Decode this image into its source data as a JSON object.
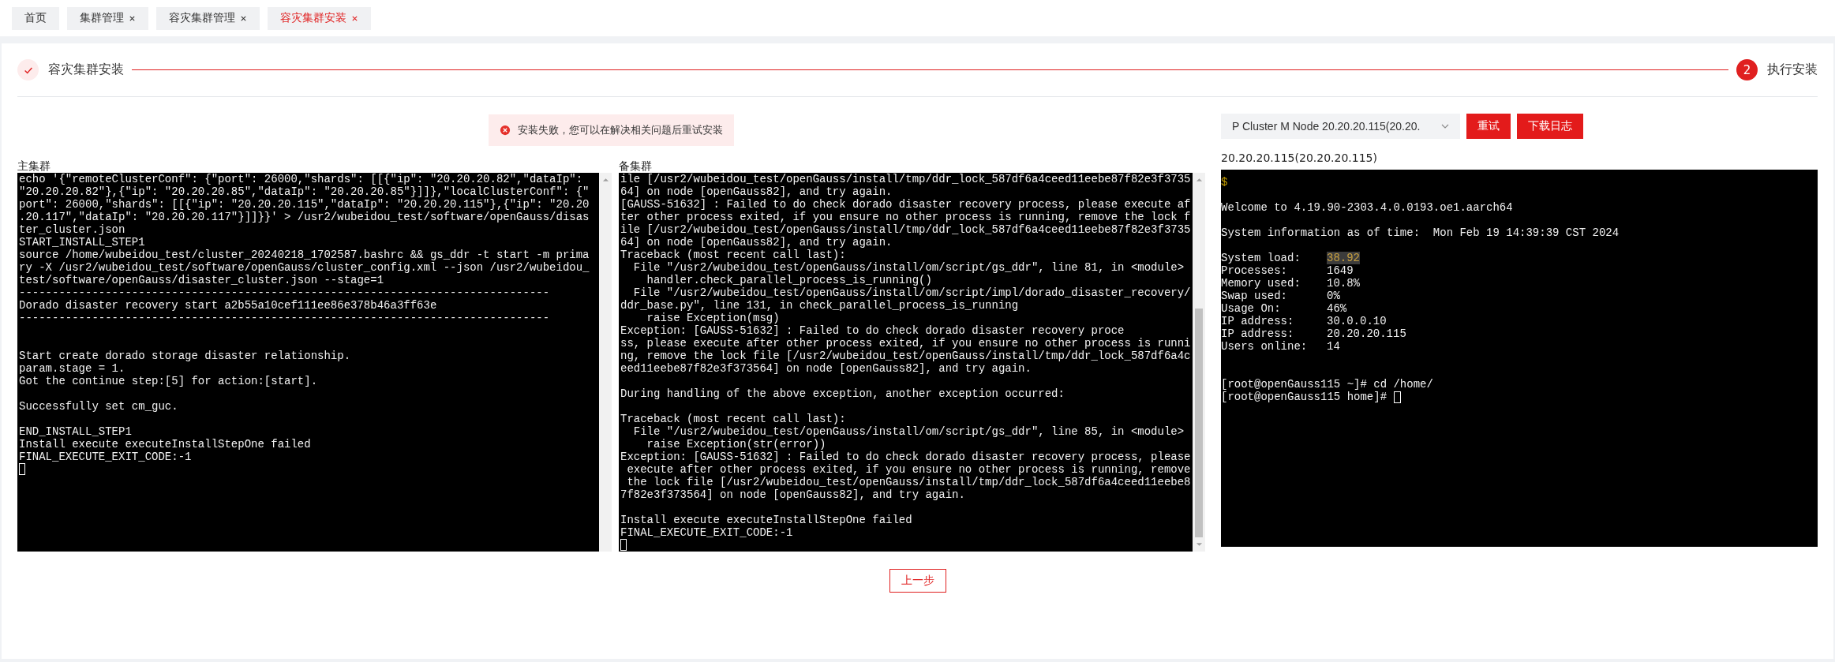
{
  "tabs": [
    {
      "label": "首页",
      "selected": false,
      "closable": false
    },
    {
      "label": "集群管理",
      "selected": false,
      "closable": true
    },
    {
      "label": "容灾集群管理",
      "selected": false,
      "closable": true
    },
    {
      "label": "容灾集群安装",
      "selected": true,
      "closable": true
    }
  ],
  "steps": [
    {
      "title": "容灾集群安装",
      "kind": "done"
    },
    {
      "title": "执行安装",
      "kind": "active",
      "number": "2"
    }
  ],
  "alert": {
    "kind": "error",
    "message": "安装失败，您可以在解决相关问题后重试安装"
  },
  "node_select": {
    "value": "P Cluster M Node 20.20.20.115(20.20."
  },
  "buttons": [
    "重试",
    "下载日志"
  ],
  "primary_terminal": {
    "label": "主集群",
    "output": "echo '{\"remoteClusterConf\": {\"port\": 26000,\"shards\": [[{\"ip\": \"20.20.20.82\",\"dataIp\":\n\"20.20.20.82\"},{\"ip\": \"20.20.20.85\",\"dataIp\": \"20.20.20.85\"}]]},\"localClusterConf\": {\"\nport\": 26000,\"shards\": [[{\"ip\": \"20.20.20.115\",\"dataIp\": \"20.20.20.115\"},{\"ip\": \"20.20\n.20.117\",\"dataIp\": \"20.20.20.117\"}]]}}' > /usr2/wubeidou_test/software/openGauss/disas\nter_cluster.json\nSTART_INSTALL_STEP1\nsource /home/wubeidou_test/cluster_20240218_1702587.bashrc && gs_ddr -t start -m prima\nry -X /usr2/wubeidou_test/software/openGauss/cluster_config.xml --json /usr2/wubeidou_\ntest/software/openGauss/disaster_cluster.json --stage=1\n--------------------------------------------------------------------------------\nDorado disaster recovery start a2b55a10cef111ee86e378b46a3ff63e\n--------------------------------------------------------------------------------\n\n\nStart create dorado storage disaster relationship.\nparam.stage = 1.\nGot the continue step:[5] for action:[start].\n\nSuccessfully set cm_guc.\n\nEND_INSTALL_STEP1\nInstall execute executeInstallStepOne failed\nFINAL_EXECUTE_EXIT_CODE:-1"
  },
  "standby_terminal": {
    "label": "备集群",
    "output": "ile [/usr2/wubeidou_test/openGauss/install/tmp/ddr_lock_587df6a4ceed11eebe87f82e3f3735\n64] on node [openGauss82], and try again.\n[GAUSS-51632] : Failed to do check dorado disaster recovery process, please execute af\nter other process exited, if you ensure no other process is running, remove the lock f\nile [/usr2/wubeidou_test/openGauss/install/tmp/ddr_lock_587df6a4ceed11eebe87f82e3f3735\n64] on node [openGauss82], and try again.\nTraceback (most recent call last):\n  File \"/usr2/wubeidou_test/openGauss/install/om/script/gs_ddr\", line 81, in <module>\n    handler.check_parallel_process_is_running()\n  File \"/usr2/wubeidou_test/openGauss/install/om/script/impl/dorado_disaster_recovery/\nddr_base.py\", line 131, in check_parallel_process_is_running\n    raise Exception(msg)\nException: [GAUSS-51632] : Failed to do check dorado disaster recovery proce\nss, please execute after other process exited, if you ensure no other process is runni\nng, remove the lock file [/usr2/wubeidou_test/openGauss/install/tmp/ddr_lock_587df6a4c\need11eebe87f82e3f373564] on node [openGauss82], and try again.\n\nDuring handling of the above exception, another exception occurred:\n\nTraceback (most recent call last):\n  File \"/usr2/wubeidou_test/openGauss/install/om/script/gs_ddr\", line 85, in <module>\n    raise Exception(str(error))\nException: [GAUSS-51632] : Failed to do check dorado disaster recovery process, please\n execute after other process exited, if you ensure no other process is running, remove\n the lock file [/usr2/wubeidou_test/openGauss/install/tmp/ddr_lock_587df6a4ceed11eebe8\n7f82e3f373564] on node [openGauss82], and try again.\n\nInstall execute executeInstallStepOne failed\nFINAL_EXECUTE_EXIT_CODE:-1"
  },
  "node_terminal": {
    "label": "20.20.20.115(20.20.20.115)",
    "prompt": "$",
    "welcome": "Welcome to 4.19.90-2303.4.0.0193.oe1.aarch64",
    "sysinfo": "System information as of time:  Mon Feb 19 14:39:39 CST 2024",
    "stats": [
      {
        "label": "System load:",
        "value": "38.92",
        "highlighted": true
      },
      {
        "label": "Processes:",
        "value": "1649",
        "highlighted": false
      },
      {
        "label": "Memory used:",
        "value": "10.8%",
        "highlighted": false
      },
      {
        "label": "Swap used:",
        "value": "0%",
        "highlighted": false
      },
      {
        "label": "Usage On:",
        "value": "46%",
        "highlighted": false
      },
      {
        "label": "IP address:",
        "value": "30.0.0.10",
        "highlighted": false
      },
      {
        "label": "IP address:",
        "value": "20.20.20.115",
        "highlighted": false
      },
      {
        "label": "Users online:",
        "value": "14",
        "highlighted": false
      }
    ],
    "shell": [
      "[root@openGauss115 ~]# cd /home/",
      "[root@openGauss115 home]#"
    ]
  },
  "back_button": "上一步"
}
